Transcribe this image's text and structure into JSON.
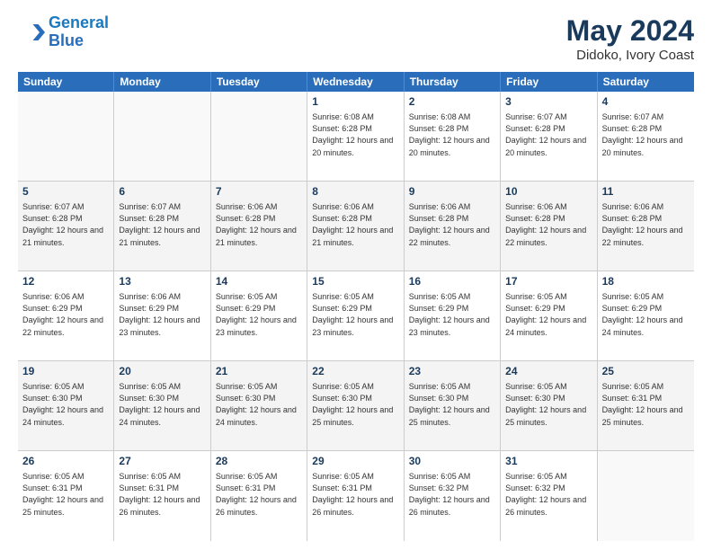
{
  "header": {
    "logo_line1": "General",
    "logo_line2": "Blue",
    "main_title": "May 2024",
    "subtitle": "Didoko, Ivory Coast"
  },
  "weekdays": [
    "Sunday",
    "Monday",
    "Tuesday",
    "Wednesday",
    "Thursday",
    "Friday",
    "Saturday"
  ],
  "rows": [
    [
      {
        "day": "",
        "empty": true
      },
      {
        "day": "",
        "empty": true
      },
      {
        "day": "",
        "empty": true
      },
      {
        "day": "1",
        "sunrise": "6:08 AM",
        "sunset": "6:28 PM",
        "daylight": "12 hours and 20 minutes."
      },
      {
        "day": "2",
        "sunrise": "6:08 AM",
        "sunset": "6:28 PM",
        "daylight": "12 hours and 20 minutes."
      },
      {
        "day": "3",
        "sunrise": "6:07 AM",
        "sunset": "6:28 PM",
        "daylight": "12 hours and 20 minutes."
      },
      {
        "day": "4",
        "sunrise": "6:07 AM",
        "sunset": "6:28 PM",
        "daylight": "12 hours and 20 minutes."
      }
    ],
    [
      {
        "day": "5",
        "sunrise": "6:07 AM",
        "sunset": "6:28 PM",
        "daylight": "12 hours and 21 minutes."
      },
      {
        "day": "6",
        "sunrise": "6:07 AM",
        "sunset": "6:28 PM",
        "daylight": "12 hours and 21 minutes."
      },
      {
        "day": "7",
        "sunrise": "6:06 AM",
        "sunset": "6:28 PM",
        "daylight": "12 hours and 21 minutes."
      },
      {
        "day": "8",
        "sunrise": "6:06 AM",
        "sunset": "6:28 PM",
        "daylight": "12 hours and 21 minutes."
      },
      {
        "day": "9",
        "sunrise": "6:06 AM",
        "sunset": "6:28 PM",
        "daylight": "12 hours and 22 minutes."
      },
      {
        "day": "10",
        "sunrise": "6:06 AM",
        "sunset": "6:28 PM",
        "daylight": "12 hours and 22 minutes."
      },
      {
        "day": "11",
        "sunrise": "6:06 AM",
        "sunset": "6:28 PM",
        "daylight": "12 hours and 22 minutes."
      }
    ],
    [
      {
        "day": "12",
        "sunrise": "6:06 AM",
        "sunset": "6:29 PM",
        "daylight": "12 hours and 22 minutes."
      },
      {
        "day": "13",
        "sunrise": "6:06 AM",
        "sunset": "6:29 PM",
        "daylight": "12 hours and 23 minutes."
      },
      {
        "day": "14",
        "sunrise": "6:05 AM",
        "sunset": "6:29 PM",
        "daylight": "12 hours and 23 minutes."
      },
      {
        "day": "15",
        "sunrise": "6:05 AM",
        "sunset": "6:29 PM",
        "daylight": "12 hours and 23 minutes."
      },
      {
        "day": "16",
        "sunrise": "6:05 AM",
        "sunset": "6:29 PM",
        "daylight": "12 hours and 23 minutes."
      },
      {
        "day": "17",
        "sunrise": "6:05 AM",
        "sunset": "6:29 PM",
        "daylight": "12 hours and 24 minutes."
      },
      {
        "day": "18",
        "sunrise": "6:05 AM",
        "sunset": "6:29 PM",
        "daylight": "12 hours and 24 minutes."
      }
    ],
    [
      {
        "day": "19",
        "sunrise": "6:05 AM",
        "sunset": "6:30 PM",
        "daylight": "12 hours and 24 minutes."
      },
      {
        "day": "20",
        "sunrise": "6:05 AM",
        "sunset": "6:30 PM",
        "daylight": "12 hours and 24 minutes."
      },
      {
        "day": "21",
        "sunrise": "6:05 AM",
        "sunset": "6:30 PM",
        "daylight": "12 hours and 24 minutes."
      },
      {
        "day": "22",
        "sunrise": "6:05 AM",
        "sunset": "6:30 PM",
        "daylight": "12 hours and 25 minutes."
      },
      {
        "day": "23",
        "sunrise": "6:05 AM",
        "sunset": "6:30 PM",
        "daylight": "12 hours and 25 minutes."
      },
      {
        "day": "24",
        "sunrise": "6:05 AM",
        "sunset": "6:30 PM",
        "daylight": "12 hours and 25 minutes."
      },
      {
        "day": "25",
        "sunrise": "6:05 AM",
        "sunset": "6:31 PM",
        "daylight": "12 hours and 25 minutes."
      }
    ],
    [
      {
        "day": "26",
        "sunrise": "6:05 AM",
        "sunset": "6:31 PM",
        "daylight": "12 hours and 25 minutes."
      },
      {
        "day": "27",
        "sunrise": "6:05 AM",
        "sunset": "6:31 PM",
        "daylight": "12 hours and 26 minutes."
      },
      {
        "day": "28",
        "sunrise": "6:05 AM",
        "sunset": "6:31 PM",
        "daylight": "12 hours and 26 minutes."
      },
      {
        "day": "29",
        "sunrise": "6:05 AM",
        "sunset": "6:31 PM",
        "daylight": "12 hours and 26 minutes."
      },
      {
        "day": "30",
        "sunrise": "6:05 AM",
        "sunset": "6:32 PM",
        "daylight": "12 hours and 26 minutes."
      },
      {
        "day": "31",
        "sunrise": "6:05 AM",
        "sunset": "6:32 PM",
        "daylight": "12 hours and 26 minutes."
      },
      {
        "day": "",
        "empty": true
      }
    ]
  ]
}
